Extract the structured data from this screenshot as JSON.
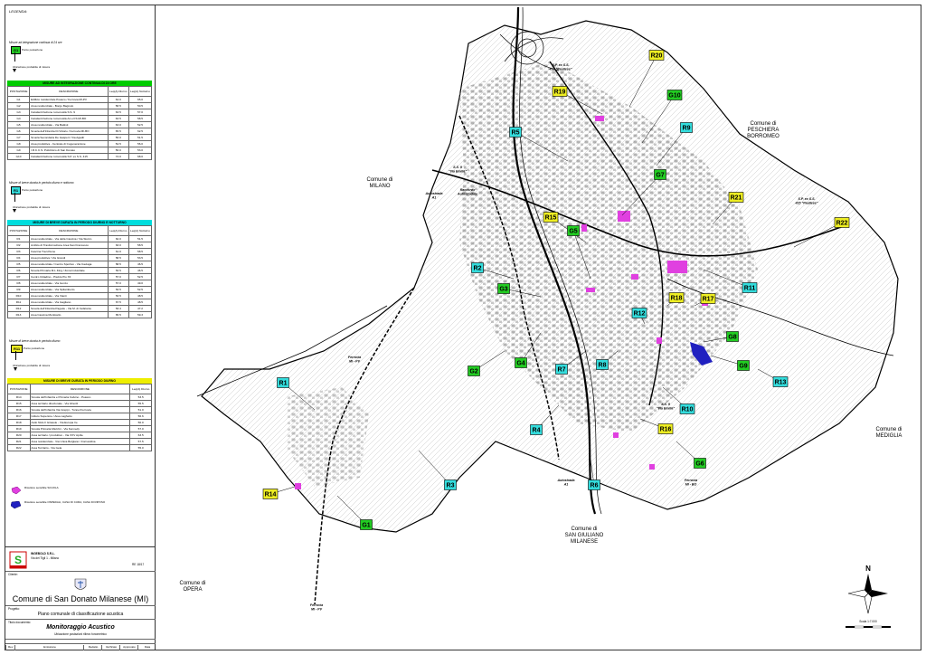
{
  "legend": {
    "title": "LEGENDA:",
    "g_intro": "Misure ad integrazione continua di 24 ore",
    "g_sample": "G1",
    "point_label": "Punto postazione",
    "direction_label": "Ubicazione probabile di misura",
    "r_intro": "Misure di breve durata in periodo diurno e notturno",
    "r_sample": "R1",
    "r11_intro": "Misure di breve durata in periodo diurno",
    "r11_sample": "R11",
    "school_label": "Ricettore sensibile SCUOLA",
    "hospital_label": "Ricettore sensibile OSPEDALI, CASA DI CURA, CASA DI RIPOSO",
    "school_color": "#e040e0",
    "hospital_color": "#2020c0"
  },
  "table_g": {
    "title": "MISURE AD INTEGRAZIONE CONTINUA DI 24 ORE",
    "header_color": "#00cc00",
    "columns": [
      "POSTAZIONE",
      "DESCRIZIONE",
      "Leq(A) Diurno",
      "Leq(A) Notturno"
    ],
    "rows": [
      [
        "G1",
        "Edificio residenziale Poasco / Ferrovia MI-PV",
        "64.0",
        "65.0"
      ],
      [
        "G2",
        "Area residenziale - Borgo Bagnolo",
        "58.5",
        "50.5"
      ],
      [
        "G3",
        "Caratterizzazione rumorosità S.S. 9",
        "63.5",
        "57.0"
      ],
      [
        "G4",
        "Caratterizzazione rumorosità A1 e FS MI-BO",
        "63.5",
        "58.5"
      ],
      [
        "G5",
        "Area residenziale - Via Battisti",
        "63.0",
        "52.5"
      ],
      [
        "G6",
        "Scuola dell'Infanzia Di Vittorio / Ferrovia MI-BO",
        "65.5",
        "62.5"
      ],
      [
        "G7",
        "Scuola Secondaria De Gasperi / Via Agadir",
        "56.0",
        "51.5"
      ],
      [
        "G8",
        "Area produttiva - Centrale di Cogenerazione",
        "54.5",
        "56.0"
      ],
      [
        "G9",
        "I.R.C.C.S. Policlinico di San Donato",
        "56.0",
        "53.0"
      ],
      [
        "G10",
        "Caratterizzazione rumorosità S.P. ex S.S. 415",
        "74.0",
        "68.0"
      ]
    ]
  },
  "table_r": {
    "title": "MISURE DI BREVE DURATA IN PERIODO DIURNO E NOTTURNO",
    "header_color": "#00dddd",
    "columns": [
      "POSTAZIONE",
      "DESCRIZIONE",
      "Leq(A) Diurno",
      "Leq(A) Notturno"
    ],
    "rows": [
      [
        "R1",
        "Area residenziale - Via della Cascina / Via Sturzo",
        "62.0",
        "51.5"
      ],
      [
        "R2",
        "Ambito di Trasformazione Area San Francesco",
        "63.0",
        "58.5"
      ],
      [
        "R3",
        "Cascina Trecchione",
        "61.0",
        "58.5"
      ],
      [
        "R4",
        "Area produttiva / Via Grandi",
        "58.5",
        "53.5"
      ],
      [
        "R5",
        "Area residenziale / Centro Sportivo - Via Caviaga",
        "58.5",
        "46.5"
      ],
      [
        "R6",
        "Scuola Primaria M.L.King / Zona Industriale",
        "53.5",
        "46.5"
      ],
      [
        "R7",
        "Centro Cittadino - Piazza Pio XII",
        "57.0",
        "52.5"
      ],
      [
        "R8",
        "Area residenziale - Via Isonzo",
        "57.0",
        "49.0"
      ],
      [
        "R9",
        "Area residenziale - Via Spilamberto",
        "53.5",
        "52.5"
      ],
      [
        "R10",
        "Area residenziale - Via Vianti",
        "53.5",
        "48.5"
      ],
      [
        "R11",
        "Area residenziale - Via Gagliano",
        "67.5",
        "48.5"
      ],
      [
        "R12",
        "Scuola dell'Infanzia Pagode - Via M. di Cefalonia",
        "53.4",
        "47.2"
      ],
      [
        "R13",
        "Area Cascina Monticello",
        "65.5",
        "59.3"
      ]
    ]
  },
  "table_d": {
    "title": "MISURE DI BREVE DURATA IN PERIODO DIURNO",
    "header_color": "#eeee00",
    "columns": [
      "POSTAZIONE",
      "DESCRIZIONE",
      "Leq(A) Diurno"
    ],
    "rows": [
      [
        "R14",
        "Scuola dell'Infanzia e Primaria Calvino - Poasco",
        "53.5"
      ],
      [
        "R15",
        "Area terziario direzionale - Via Gherdi",
        "55.5"
      ],
      [
        "R16",
        "Scuola dell'Infanzia Via Greppi - Tunnel Ferrovia",
        "51.0"
      ],
      [
        "R17",
        "Istituto Superiore / Area Laghetto",
        "56.6"
      ],
      [
        "R18",
        "Asilo Nido Il Girasole - Via Europa Ire",
        "50.0"
      ],
      [
        "R19",
        "Scuola Primaria Mazzini - Via Kennedy",
        "57.0"
      ],
      [
        "R20",
        "Area terziario / produttivo - Via XXV Aprile",
        "63.5"
      ],
      [
        "R21",
        "Area residenziale - Via Unica Bolgiano / Fornandina",
        "57.5"
      ],
      [
        "R22",
        "Area Terziario - Via Gela",
        "55.0"
      ]
    ]
  },
  "title_block": {
    "company": "INGEBOLD S.R.L.",
    "company_address": "Via dei Tigli 1 - Milano",
    "ref_code": "RE 18/17",
    "client_label": "Cliente:",
    "client": "Comune di San Donato Milanese (MI)",
    "project_label": "Progetto:",
    "project": "Piano comunale di classificazione acustica",
    "doc_label": "Titolo documento:",
    "doc_title": "Monitoraggio Acustico",
    "doc_subtitle": "Ubicazione postazioni rilievo fonometrico",
    "footer_cols": [
      "Rev.",
      "Emissione",
      "Redatto",
      "Verificato",
      "Approvato",
      "Data"
    ]
  },
  "map": {
    "municipalities": [
      {
        "id": "milano",
        "lines": [
          "Comune di",
          "MILANO"
        ]
      },
      {
        "id": "peschiera",
        "lines": [
          "Comune di",
          "PESCHIERA",
          "BORROMEO"
        ]
      },
      {
        "id": "mediglia",
        "lines": [
          "Comune di",
          "MEDIGLIA"
        ]
      },
      {
        "id": "sangiuliano",
        "lines": [
          "Comune di",
          "SAN GIULIANO",
          "MILANESE"
        ]
      },
      {
        "id": "opera",
        "lines": [
          "Comune di",
          "OPERA"
        ]
      }
    ],
    "road_labels": [
      {
        "id": "sp415n",
        "lines": [
          "S.P. ex S.S.",
          "415 \"Paullese\""
        ]
      },
      {
        "id": "sp415e",
        "lines": [
          "S.P. ex S.S.",
          "415 \"Paullese\""
        ]
      },
      {
        "id": "ss9n",
        "lines": [
          "S.S. 9",
          "\"Via Emilia\""
        ]
      },
      {
        "id": "ss9s",
        "lines": [
          "S.S. 9",
          "\"Via Emilia\""
        ]
      },
      {
        "id": "a1n",
        "lines": [
          "Autostrada",
          "A1"
        ]
      },
      {
        "id": "racc",
        "lines": [
          "Raccordo",
          "Autostradale"
        ]
      },
      {
        "id": "fmipv1",
        "lines": [
          "Ferrovia",
          "MI - PV"
        ]
      },
      {
        "id": "fmipv2",
        "lines": [
          "Ferrovia",
          "MI - PV"
        ]
      },
      {
        "id": "a1s",
        "lines": [
          "Autostrada",
          "A1"
        ]
      },
      {
        "id": "fmibo",
        "lines": [
          "Ferrovia",
          "MI - BO"
        ]
      }
    ],
    "stations": [
      {
        "id": "R20",
        "type": "d"
      },
      {
        "id": "R19",
        "type": "d"
      },
      {
        "id": "G10",
        "type": "g"
      },
      {
        "id": "R9",
        "type": "r"
      },
      {
        "id": "R5",
        "type": "r"
      },
      {
        "id": "G7",
        "type": "g"
      },
      {
        "id": "R21",
        "type": "d"
      },
      {
        "id": "R22",
        "type": "d"
      },
      {
        "id": "R15",
        "type": "d"
      },
      {
        "id": "G5",
        "type": "g"
      },
      {
        "id": "R2",
        "type": "r"
      },
      {
        "id": "G3",
        "type": "g"
      },
      {
        "id": "R11",
        "type": "r"
      },
      {
        "id": "R18",
        "type": "d"
      },
      {
        "id": "R17",
        "type": "d"
      },
      {
        "id": "R12",
        "type": "r"
      },
      {
        "id": "G8",
        "type": "g"
      },
      {
        "id": "G9",
        "type": "g"
      },
      {
        "id": "G4",
        "type": "g"
      },
      {
        "id": "G2",
        "type": "g"
      },
      {
        "id": "R7",
        "type": "r"
      },
      {
        "id": "R8",
        "type": "r"
      },
      {
        "id": "R13",
        "type": "r"
      },
      {
        "id": "R1",
        "type": "r"
      },
      {
        "id": "R10",
        "type": "r"
      },
      {
        "id": "R4",
        "type": "r"
      },
      {
        "id": "R16",
        "type": "d"
      },
      {
        "id": "G6",
        "type": "g"
      },
      {
        "id": "R3",
        "type": "r"
      },
      {
        "id": "R6",
        "type": "r"
      },
      {
        "id": "R14",
        "type": "d"
      },
      {
        "id": "G1",
        "type": "g"
      }
    ],
    "station_colors": {
      "g": "#22cc22",
      "r": "#33dddd",
      "d": "#eeee22"
    },
    "compass_letter": "N",
    "scale_label": "Scala 1:7.000"
  }
}
